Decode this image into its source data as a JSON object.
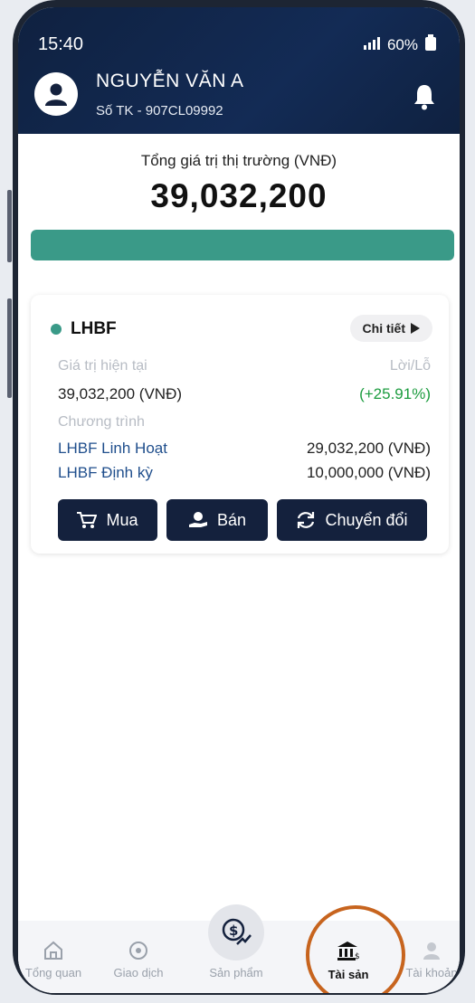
{
  "status_bar": {
    "time": "15:40",
    "battery": "60%"
  },
  "header": {
    "user_name": "NGUYỄN VĂN A",
    "account": "Số TK - 907CL09992"
  },
  "summary": {
    "label": "Tổng giá trị thị trường (VNĐ)",
    "value": "39,032,200",
    "progress": 1.0
  },
  "card": {
    "fund": "LHBF",
    "detail_label": "Chi tiết",
    "current_value_label": "Giá trị hiện tại",
    "current_value": "39,032,200 (VNĐ)",
    "pnl_label": "Lời/Lỗ",
    "pnl_value": "(+25.91%)",
    "program_label": "Chương trình",
    "programs": [
      {
        "name": "LHBF Linh Hoạt",
        "value": "29,032,200 (VNĐ)"
      },
      {
        "name": "LHBF Định kỳ",
        "value": "10,000,000 (VNĐ)"
      }
    ],
    "buttons": {
      "buy": "Mua",
      "sell": "Bán",
      "convert": "Chuyển đổi"
    }
  },
  "nav": {
    "items": [
      {
        "label": "Tổng quan"
      },
      {
        "label": "Giao dịch"
      },
      {
        "label": "Sản phẩm"
      },
      {
        "label": "Tài sản"
      },
      {
        "label": "Tài khoản"
      }
    ],
    "active": "Tài sản"
  },
  "colors": {
    "brand": "#14213d",
    "accent": "#3a9a88",
    "gain": "#1c9c3f",
    "highlight": "#c7641e"
  }
}
